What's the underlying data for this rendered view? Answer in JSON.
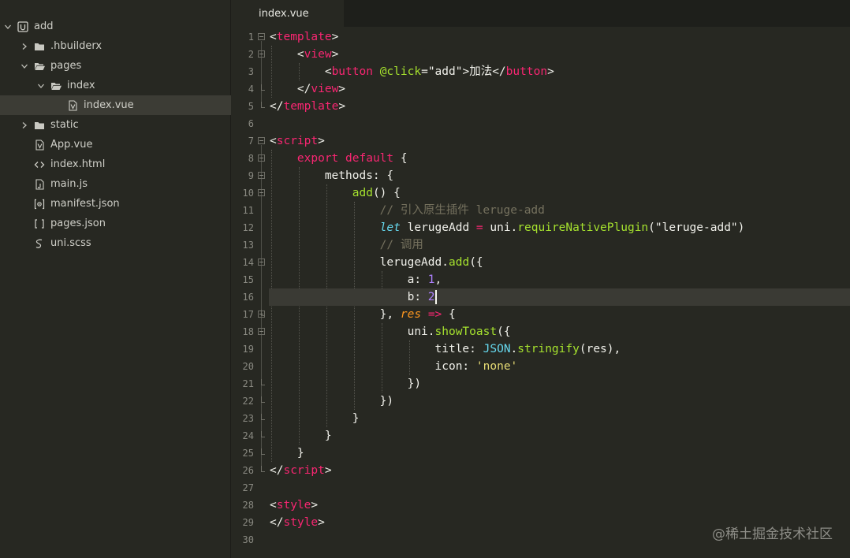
{
  "sidebar": {
    "items": [
      {
        "label": "add",
        "icon": "project-icon",
        "expanded": true,
        "depth": 0
      },
      {
        "label": ".hbuilderx",
        "icon": "folder-icon",
        "expanded": false,
        "depth": 1
      },
      {
        "label": "pages",
        "icon": "folder-open-icon",
        "expanded": true,
        "depth": 1
      },
      {
        "label": "index",
        "icon": "folder-open-icon",
        "expanded": true,
        "depth": 2
      },
      {
        "label": "index.vue",
        "icon": "vue-file-icon",
        "selected": true,
        "depth": 3
      },
      {
        "label": "static",
        "icon": "folder-icon",
        "expanded": false,
        "depth": 1
      },
      {
        "label": "App.vue",
        "icon": "vue-file-icon",
        "depth": 1
      },
      {
        "label": "index.html",
        "icon": "html-file-icon",
        "depth": 1
      },
      {
        "label": "main.js",
        "icon": "js-file-icon",
        "depth": 1
      },
      {
        "label": "manifest.json",
        "icon": "manifest-file-icon",
        "depth": 1
      },
      {
        "label": "pages.json",
        "icon": "json-file-icon",
        "depth": 1
      },
      {
        "label": "uni.scss",
        "icon": "scss-file-icon",
        "depth": 1
      }
    ]
  },
  "tabs": [
    {
      "label": "index.vue",
      "active": true
    }
  ],
  "editor": {
    "current_line": 16,
    "lines": [
      {
        "n": "1",
        "indent": 0,
        "tokens": [
          [
            "punc",
            "<"
          ],
          [
            "tag",
            "template"
          ],
          [
            "punc",
            ">"
          ]
        ]
      },
      {
        "n": "2",
        "indent": 1,
        "tokens": [
          [
            "punc",
            "<"
          ],
          [
            "tag",
            "view"
          ],
          [
            "punc",
            ">"
          ]
        ]
      },
      {
        "n": "3",
        "indent": 2,
        "tokens": [
          [
            "punc",
            "<"
          ],
          [
            "tag",
            "button"
          ],
          [
            "plain",
            " "
          ],
          [
            "attr",
            "@click"
          ],
          [
            "punc",
            "="
          ],
          [
            "str",
            "\"add\""
          ],
          [
            "punc",
            ">"
          ],
          [
            "plain",
            "加法"
          ],
          [
            "punc",
            "</"
          ],
          [
            "tag",
            "button"
          ],
          [
            "punc",
            ">"
          ]
        ]
      },
      {
        "n": "4",
        "indent": 1,
        "tokens": [
          [
            "punc",
            "</"
          ],
          [
            "tag",
            "view"
          ],
          [
            "punc",
            ">"
          ]
        ]
      },
      {
        "n": "5",
        "indent": 0,
        "tokens": [
          [
            "punc",
            "</"
          ],
          [
            "tag",
            "template"
          ],
          [
            "punc",
            ">"
          ]
        ]
      },
      {
        "n": "6",
        "indent": 0,
        "tokens": []
      },
      {
        "n": "7",
        "indent": 0,
        "tokens": [
          [
            "punc",
            "<"
          ],
          [
            "tag",
            "script"
          ],
          [
            "punc",
            ">"
          ]
        ]
      },
      {
        "n": "8",
        "indent": 1,
        "tokens": [
          [
            "kw",
            "export"
          ],
          [
            "plain",
            " "
          ],
          [
            "kw",
            "default"
          ],
          [
            "plain",
            " {"
          ]
        ]
      },
      {
        "n": "9",
        "indent": 2,
        "tokens": [
          [
            "plain",
            "methods: {"
          ]
        ]
      },
      {
        "n": "10",
        "indent": 3,
        "tokens": [
          [
            "fn",
            "add"
          ],
          [
            "plain",
            "() {"
          ]
        ]
      },
      {
        "n": "11",
        "indent": 4,
        "tokens": [
          [
            "comment",
            "// 引入原生插件 leruge-add"
          ]
        ]
      },
      {
        "n": "12",
        "indent": 4,
        "tokens": [
          [
            "storage",
            "let"
          ],
          [
            "plain",
            " lerugeAdd "
          ],
          [
            "op",
            "="
          ],
          [
            "plain",
            " uni."
          ],
          [
            "fn",
            "requireNativePlugin"
          ],
          [
            "plain",
            "(\"leruge-add\")"
          ]
        ]
      },
      {
        "n": "13",
        "indent": 4,
        "tokens": [
          [
            "comment",
            "// 调用"
          ]
        ]
      },
      {
        "n": "14",
        "indent": 4,
        "tokens": [
          [
            "plain",
            "lerugeAdd."
          ],
          [
            "fn",
            "add"
          ],
          [
            "plain",
            "({"
          ]
        ]
      },
      {
        "n": "15",
        "indent": 5,
        "tokens": [
          [
            "plain",
            "a: "
          ],
          [
            "num",
            "1"
          ],
          [
            "plain",
            ","
          ]
        ]
      },
      {
        "n": "16",
        "indent": 5,
        "tokens": [
          [
            "plain",
            "b: "
          ],
          [
            "num",
            "2"
          ]
        ]
      },
      {
        "n": "17",
        "indent": 4,
        "tokens": [
          [
            "plain",
            "}, "
          ],
          [
            "param",
            "res"
          ],
          [
            "plain",
            " "
          ],
          [
            "op",
            "=>"
          ],
          [
            "plain",
            " {"
          ]
        ]
      },
      {
        "n": "18",
        "indent": 5,
        "tokens": [
          [
            "plain",
            "uni."
          ],
          [
            "fn",
            "showToast"
          ],
          [
            "plain",
            "({"
          ]
        ]
      },
      {
        "n": "19",
        "indent": 6,
        "tokens": [
          [
            "plain",
            "title: "
          ],
          [
            "const",
            "JSON"
          ],
          [
            "plain",
            "."
          ],
          [
            "fn",
            "stringify"
          ],
          [
            "plain",
            "(res),"
          ]
        ]
      },
      {
        "n": "20",
        "indent": 6,
        "tokens": [
          [
            "plain",
            "icon: "
          ],
          [
            "sq",
            "'none'"
          ]
        ]
      },
      {
        "n": "21",
        "indent": 5,
        "tokens": [
          [
            "plain",
            "})"
          ]
        ]
      },
      {
        "n": "22",
        "indent": 4,
        "tokens": [
          [
            "plain",
            "})"
          ]
        ]
      },
      {
        "n": "23",
        "indent": 3,
        "tokens": [
          [
            "plain",
            "}"
          ]
        ]
      },
      {
        "n": "24",
        "indent": 2,
        "tokens": [
          [
            "plain",
            "}"
          ]
        ]
      },
      {
        "n": "25",
        "indent": 1,
        "tokens": [
          [
            "plain",
            "}"
          ]
        ]
      },
      {
        "n": "26",
        "indent": 0,
        "tokens": [
          [
            "punc",
            "</"
          ],
          [
            "tag",
            "script"
          ],
          [
            "punc",
            ">"
          ]
        ]
      },
      {
        "n": "27",
        "indent": 0,
        "tokens": []
      },
      {
        "n": "28",
        "indent": 0,
        "tokens": [
          [
            "punc",
            "<"
          ],
          [
            "tag",
            "style"
          ],
          [
            "punc",
            ">"
          ]
        ]
      },
      {
        "n": "29",
        "indent": 0,
        "tokens": [
          [
            "punc",
            "</"
          ],
          [
            "tag",
            "style"
          ],
          [
            "punc",
            ">"
          ]
        ]
      },
      {
        "n": "30",
        "indent": 0,
        "tokens": []
      }
    ]
  },
  "watermark": "@稀土掘金技术社区",
  "colors": {
    "background": "#272822",
    "tag": "#f92672",
    "function": "#a6e22e",
    "comment": "#75715e",
    "number": "#ae81ff",
    "string_single": "#e6db74",
    "builtin": "#66d9ef",
    "parameter": "#fd971f"
  }
}
